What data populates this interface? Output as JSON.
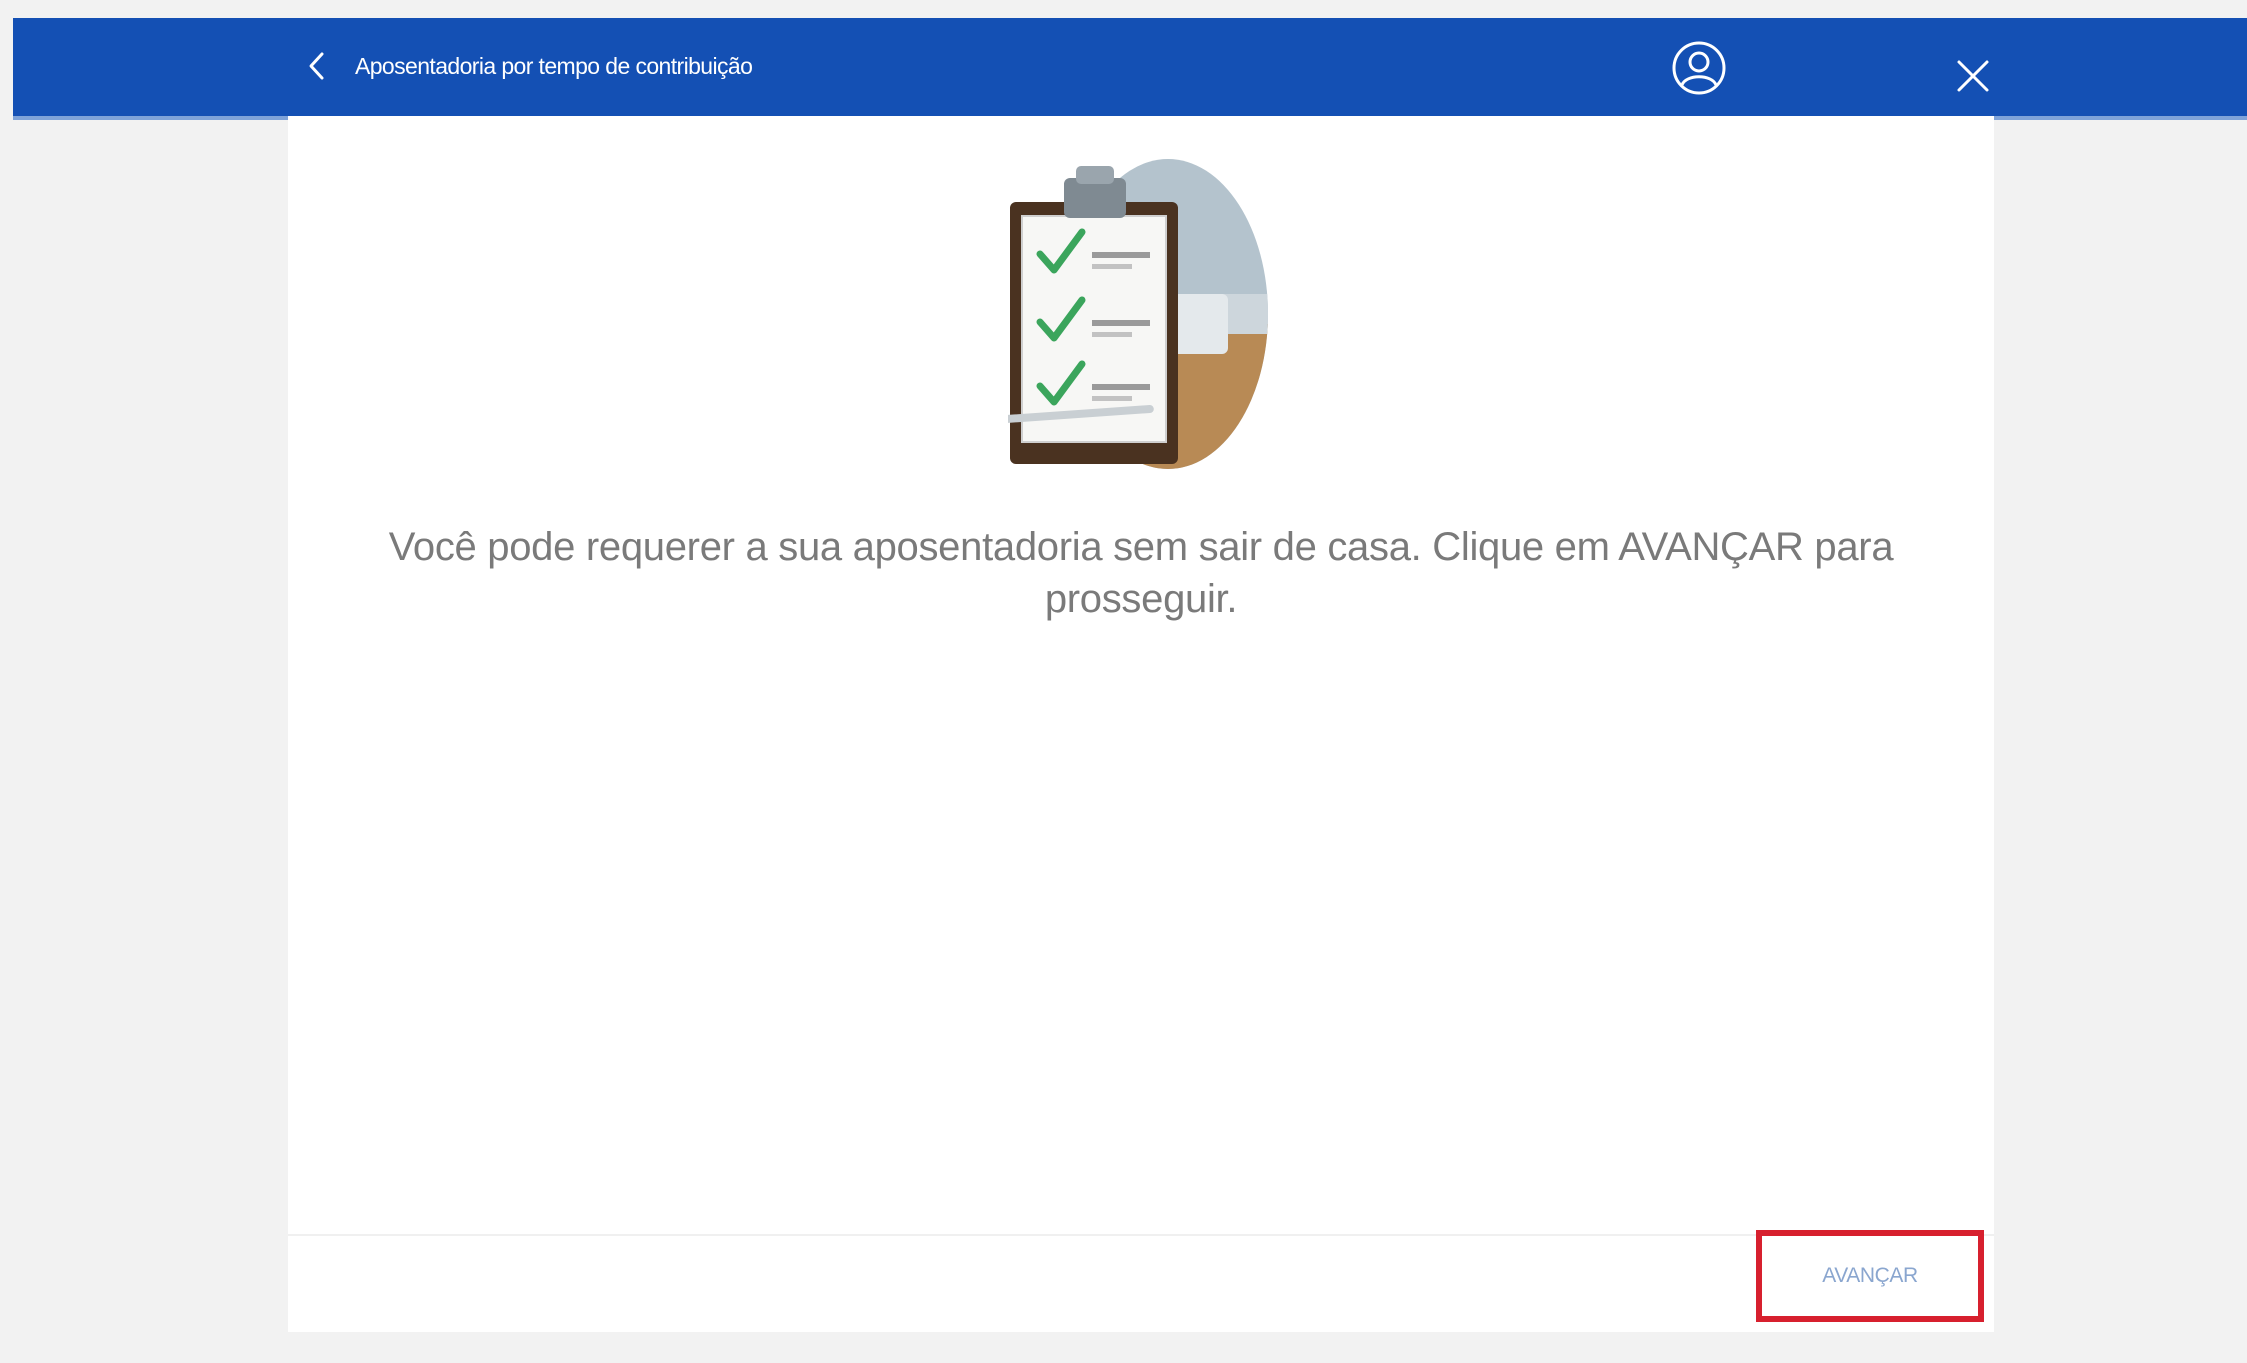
{
  "header": {
    "title": "Aposentadoria por tempo de contribuição",
    "back_icon": "chevron-left-icon",
    "user_icon": "user-circle-icon",
    "close_icon": "close-icon",
    "background_color": "#1450b4"
  },
  "main": {
    "illustration": "clipboard-checklist-illustration",
    "message": "Você pode requerer a sua aposentadoria sem sair de casa. Clique em AVANÇAR para prosseguir."
  },
  "footer": {
    "next_label": "AVANÇAR",
    "highlight_color": "#d7202e"
  }
}
